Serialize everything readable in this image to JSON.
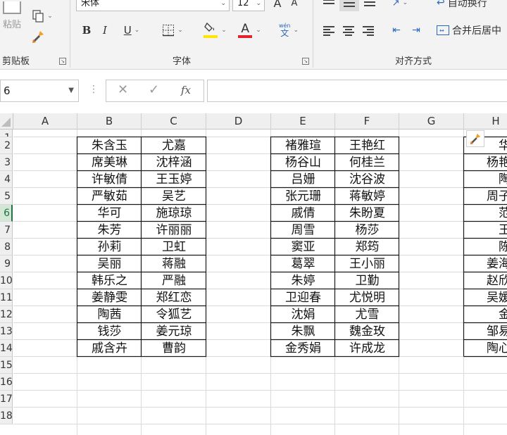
{
  "ribbon": {
    "clipboard": {
      "paste_label": "粘贴",
      "group_label": "剪贴板"
    },
    "font": {
      "font_name": "宋体",
      "font_size": "12",
      "group_label": "字体",
      "bold": "B",
      "italic": "I",
      "underline": "U",
      "grow": "A",
      "shrink": "A",
      "font_color": "A",
      "wen": "wén",
      "wen_char": "文",
      "fill_color_hex": "#ffe500",
      "font_color_hex": "#e0242a"
    },
    "alignment": {
      "wrap_label": "自动换行",
      "merge_label": "合并后居中",
      "group_label": "对齐方式"
    }
  },
  "formula_bar": {
    "name_box": "6",
    "fx": "fx",
    "cancel": "✕",
    "confirm": "✓",
    "formula": ""
  },
  "grid": {
    "columns": [
      "A",
      "B",
      "C",
      "D",
      "E",
      "F",
      "G",
      "H"
    ],
    "row_numbers": [
      "1",
      "2",
      "3",
      "4",
      "5",
      "6",
      "7",
      "8",
      "9",
      "10",
      "11",
      "12",
      "13",
      "14",
      "15",
      "16",
      "17",
      "18"
    ],
    "selected_row": "6",
    "rows": [
      {
        "B": "朱含玉",
        "C": "尤嘉",
        "E": "褚雅瑄",
        "F": "王艳红",
        "H": "华韵"
      },
      {
        "B": "席美琳",
        "C": "沈梓涵",
        "E": "杨谷山",
        "F": "何桂兰",
        "H": "杨艳约"
      },
      {
        "B": "许敏倩",
        "C": "王玉婷",
        "E": "吕姗",
        "F": "沈谷波",
        "H": "陶妏"
      },
      {
        "B": "严敏茹",
        "C": "吴艺",
        "E": "张元珊",
        "F": "蒋敏婷",
        "H": "周子菱"
      },
      {
        "B": "华可",
        "C": "施琼琼",
        "E": "戚倩",
        "F": "朱盼夏",
        "H": "范雁"
      },
      {
        "B": "朱芳",
        "C": "许丽丽",
        "E": "周雪",
        "F": "杨莎",
        "H": "王亚"
      },
      {
        "B": "孙莉",
        "C": "卫虹",
        "E": "窦亚",
        "F": "郑筠",
        "H": "陈娟"
      },
      {
        "B": "吴丽",
        "C": "蒋融",
        "E": "葛翠",
        "F": "王小丽",
        "H": "姜海亮"
      },
      {
        "B": "韩乐之",
        "C": "严融",
        "E": "朱婷",
        "F": "卫勤",
        "H": "赵欣玥"
      },
      {
        "B": "姜静雯",
        "C": "郑红恋",
        "E": "卫迎春",
        "F": "尤悦明",
        "H": "吴媛芳"
      },
      {
        "B": "陶茜",
        "C": "令狐艺",
        "E": "沈娟",
        "F": "尤雪",
        "H": "金涛"
      },
      {
        "B": "钱莎",
        "C": "姜元琼",
        "E": "朱飘",
        "F": "魏金玫",
        "H": "邹易君"
      },
      {
        "B": "戚含卉",
        "C": "曹韵",
        "E": "金秀娟",
        "F": "许成龙",
        "H": "陶心妍"
      }
    ]
  }
}
